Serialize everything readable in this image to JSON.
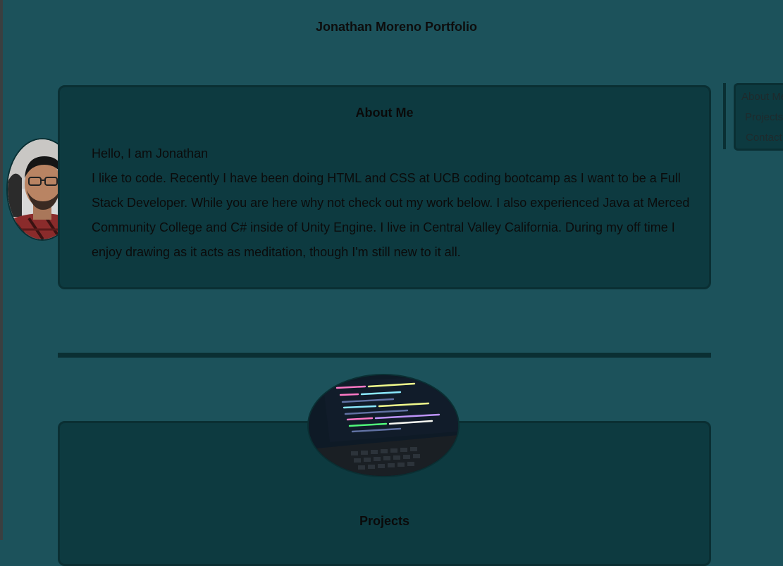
{
  "header": {
    "title": "Jonathan Moreno Portfolio"
  },
  "about": {
    "heading": "About Me",
    "greeting": "Hello, I am Jonathan",
    "body": "I like to code. Recently I have been doing HTML and CSS at UCB coding bootcamp as I want to be a Full Stack Developer. While you are here why not check out my work below. I also experienced Java at Merced Community College and C# inside of Unity Engine. I live in Central Valley California. During my off time I enjoy drawing as it acts as meditation, though I'm still new to it all."
  },
  "nav": {
    "items": [
      {
        "label": "About Me"
      },
      {
        "label": "Projects"
      },
      {
        "label": "Contact"
      }
    ]
  },
  "projects": {
    "heading": "Projects"
  },
  "colors": {
    "background": "#1c525b",
    "panel": "#0d3a40",
    "border": "#0a2f33"
  }
}
